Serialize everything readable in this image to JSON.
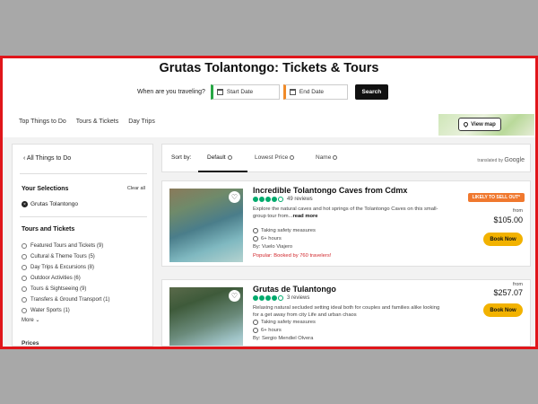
{
  "page": {
    "title": "Grutas Tolantongo: Tickets & Tours"
  },
  "datebar": {
    "prompt": "When are you traveling?",
    "start_placeholder": "Start Date",
    "end_placeholder": "End Date",
    "search_label": "Search"
  },
  "nav": {
    "tabs": [
      "Top Things to Do",
      "Tours & Tickets",
      "Day Trips"
    ],
    "view_map_label": "View map"
  },
  "sidebar": {
    "back_label": "All Things to Do",
    "selections_heading": "Your Selections",
    "clear_all": "Clear all",
    "selected_item": "Grutas Tolantongo",
    "category_heading": "Tours and Tickets",
    "filters": [
      "Featured Tours and Tickets (9)",
      "Cultural & Theme Tours (5)",
      "Day Trips & Excursions (8)",
      "Outdoor Activities (6)",
      "Tours & Sightseeing (9)",
      "Transfers & Ground Transport (1)",
      "Water Sports (1)"
    ],
    "more_label": "More",
    "prices_heading": "Prices"
  },
  "sort": {
    "label": "Sort by:",
    "options": [
      "Default",
      "Lowest Price",
      "Name"
    ],
    "active": "Default",
    "translated_by": "translated by",
    "translator": "Google"
  },
  "products": [
    {
      "title": "Incredible Tolantongo Caves from Cdmx",
      "rating": 4,
      "reviews": "49 reviews",
      "desc": "Explore the natural caves and hot springs of the Tolantongo Caves on this small-group tour from...",
      "read_more": "read more",
      "safety": "Taking safety measures",
      "duration": "6+ hours",
      "by": "By: Vuelo Viajero",
      "popular": "Popular: Booked by 760 travelers!",
      "badge": "LIKELY TO SELL OUT*",
      "from": "from",
      "price": "$105.00",
      "book": "Book Now"
    },
    {
      "title": "Grutas de Tulantongo",
      "rating": 4,
      "reviews": "3 reviews",
      "desc": "Relaxing natural secluded setting ideal both for couples and families alike looking for a get away from city Life and urban chaos",
      "safety": "Taking safety measures",
      "duration": "6+ hours",
      "by": "By: Sergio Mendiel Olvera",
      "from": "from",
      "price": "$257.07",
      "book": "Book Now"
    }
  ],
  "colors": {
    "frame_border": "#e0161b",
    "start_accent": "#28a745",
    "end_accent": "#f08a28",
    "rating_green": "#00aa6c",
    "book_button": "#f2b200",
    "badge": "#f0782e",
    "popular_text": "#d1262b"
  }
}
